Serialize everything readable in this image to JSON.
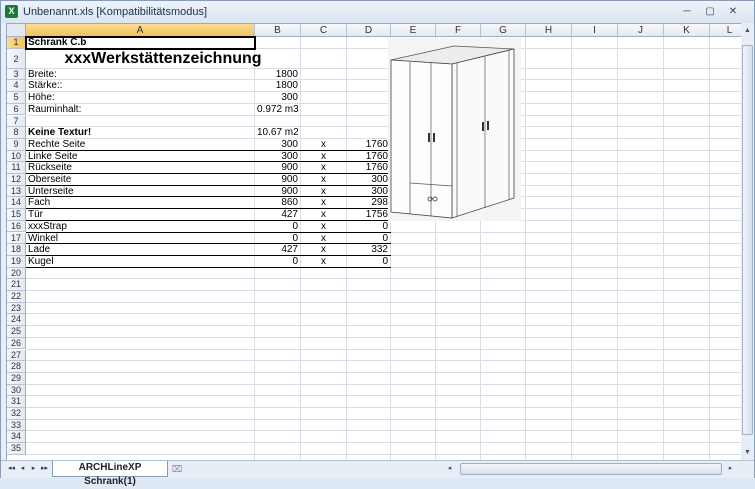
{
  "window": {
    "title": "Unbenannt.xls  [Kompatibilitätsmodus]",
    "app_icon": "excel-icon",
    "controls": [
      "─",
      "▢",
      "✕"
    ]
  },
  "columns": [
    "A",
    "B",
    "C",
    "D",
    "E",
    "F",
    "G",
    "H",
    "I",
    "J",
    "K",
    "L"
  ],
  "selected_column": "A",
  "rows": [
    "1",
    "2",
    "3",
    "4",
    "5",
    "6",
    "7",
    "8",
    "9",
    "10",
    "11",
    "12",
    "13",
    "14",
    "15",
    "16",
    "17",
    "18",
    "19",
    "20",
    "21",
    "22",
    "23",
    "24",
    "25",
    "26",
    "27",
    "28",
    "29",
    "30",
    "31",
    "32",
    "33",
    "34",
    "35"
  ],
  "selected_row": "1",
  "sheet": {
    "title": "Schrank C.b",
    "heading": "xxxWerkstättenzeichnung",
    "dimensions": [
      {
        "label": "Breite:",
        "value": "1800"
      },
      {
        "label": "Stärke::",
        "value": "1800"
      },
      {
        "label": "Höhe:",
        "value": "300"
      },
      {
        "label": "Rauminhalt:",
        "value": "0.972 m3"
      }
    ],
    "texture_label": "Keine Textur!",
    "texture_value": "10.67 m2",
    "parts": [
      {
        "name": "Rechte Seite",
        "a": "300",
        "x": "x",
        "b": "1760"
      },
      {
        "name": "Linke Seite",
        "a": "300",
        "x": "x",
        "b": "1760"
      },
      {
        "name": "Rückseite",
        "a": "900",
        "x": "x",
        "b": "1760"
      },
      {
        "name": "Oberseite",
        "a": "900",
        "x": "x",
        "b": "300"
      },
      {
        "name": "Unterseite",
        "a": "900",
        "x": "x",
        "b": "300"
      },
      {
        "name": "Fach",
        "a": "860",
        "x": "x",
        "b": "298"
      },
      {
        "name": "Tür",
        "a": "427",
        "x": "x",
        "b": "1756"
      },
      {
        "name": "xxxStrap",
        "a": "0",
        "x": "x",
        "b": "0"
      },
      {
        "name": "Winkel",
        "a": "0",
        "x": "x",
        "b": "0"
      },
      {
        "name": "Lade",
        "a": "427",
        "x": "x",
        "b": "332"
      },
      {
        "name": "Kugel",
        "a": "0",
        "x": "x",
        "b": "0"
      }
    ]
  },
  "tabs": {
    "active": "ARCHLineXP Schrank(1)",
    "nav": [
      "◂◂",
      "◂",
      "▸",
      "▸▸"
    ],
    "new_tab_icon": "insert-sheet-icon"
  },
  "scroll": {
    "up": "▲",
    "down": "▼",
    "left": "◂",
    "right": "▸"
  }
}
